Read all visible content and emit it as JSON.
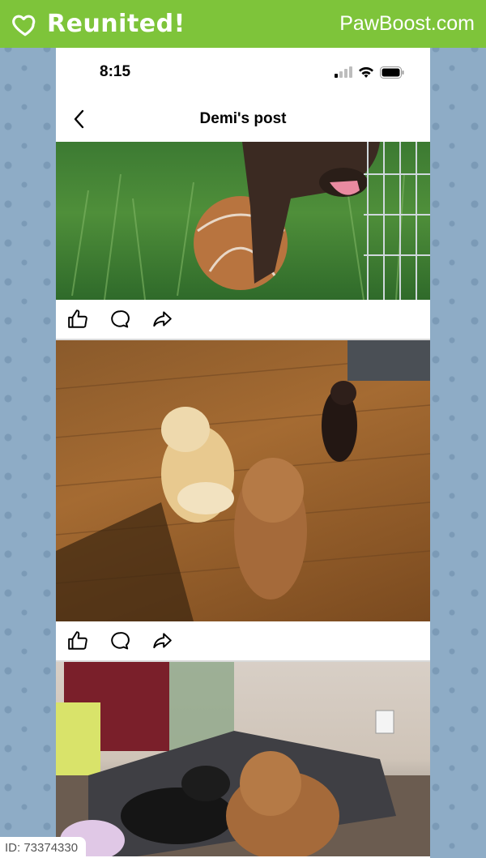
{
  "banner": {
    "title": "Reunited!",
    "brand": "PawBoost.com",
    "color": "#7ec43a"
  },
  "status_bar": {
    "time": "8:15",
    "icons": [
      "signal-icon",
      "wifi-icon",
      "battery-icon"
    ]
  },
  "header": {
    "title": "Demi's post",
    "back_icon": "chevron-left-icon"
  },
  "posts": [
    {
      "image": "dog-with-ball-on-grass",
      "actions": [
        "like-icon",
        "comment-icon",
        "share-icon"
      ]
    },
    {
      "image": "three-dogs-on-wood-floor",
      "actions": [
        "like-icon",
        "comment-icon",
        "share-icon"
      ]
    },
    {
      "image": "two-dogs-on-dog-bed",
      "actions": []
    }
  ],
  "footer": {
    "id_label": "ID: 73374330"
  }
}
